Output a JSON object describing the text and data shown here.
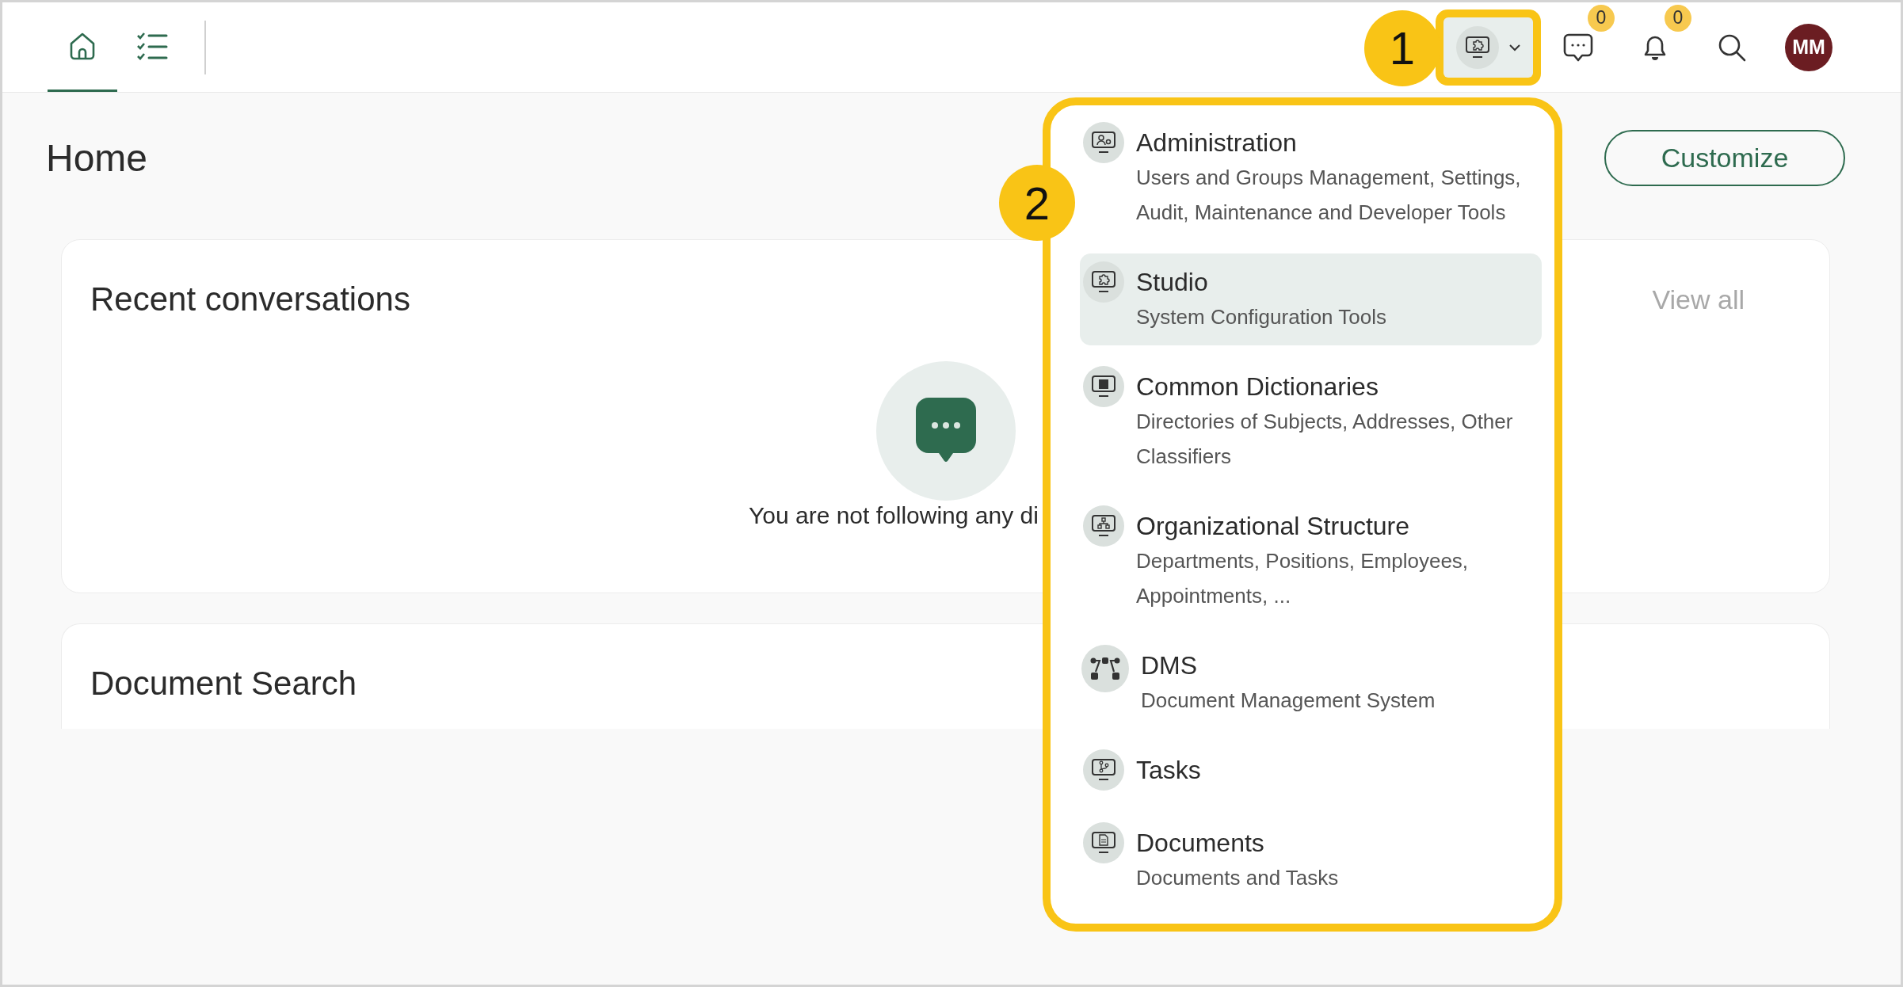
{
  "top_bar": {
    "nav_tabs": [
      {
        "selected": true
      },
      {
        "selected": false
      }
    ],
    "app_switcher": {
      "expanded": true
    },
    "messages_badge": "0",
    "notifications_badge": "0",
    "avatar": "MM"
  },
  "page": {
    "title": "Home",
    "customize_button": "Customize"
  },
  "cards": [
    {
      "title": "Recent conversations",
      "link": "View all",
      "empty_text": "You are not following any di"
    },
    {
      "title": "Document Search"
    }
  ],
  "app_menu": {
    "items": [
      {
        "title": "Administration",
        "subtitle": "Users and Groups Management, Settings, Audit, Maintenance and Developer Tools",
        "selected": false
      },
      {
        "title": "Studio",
        "subtitle": "System Configuration Tools",
        "selected": true
      },
      {
        "title": "Common Dictionaries",
        "subtitle": "Directories of Subjects, Addresses, Other Classifiers",
        "selected": false
      },
      {
        "title": "Organizational Structure",
        "subtitle": "Departments, Positions, Employees, Appointments, ...",
        "selected": false
      },
      {
        "title": "DMS",
        "subtitle": "Document Management System",
        "selected": false
      },
      {
        "title": "Tasks",
        "selected": false
      },
      {
        "title": "Documents",
        "subtitle": "Documents and Tasks",
        "selected": false
      }
    ]
  },
  "annotations": [
    {
      "label": "1"
    },
    {
      "label": "2"
    }
  ]
}
